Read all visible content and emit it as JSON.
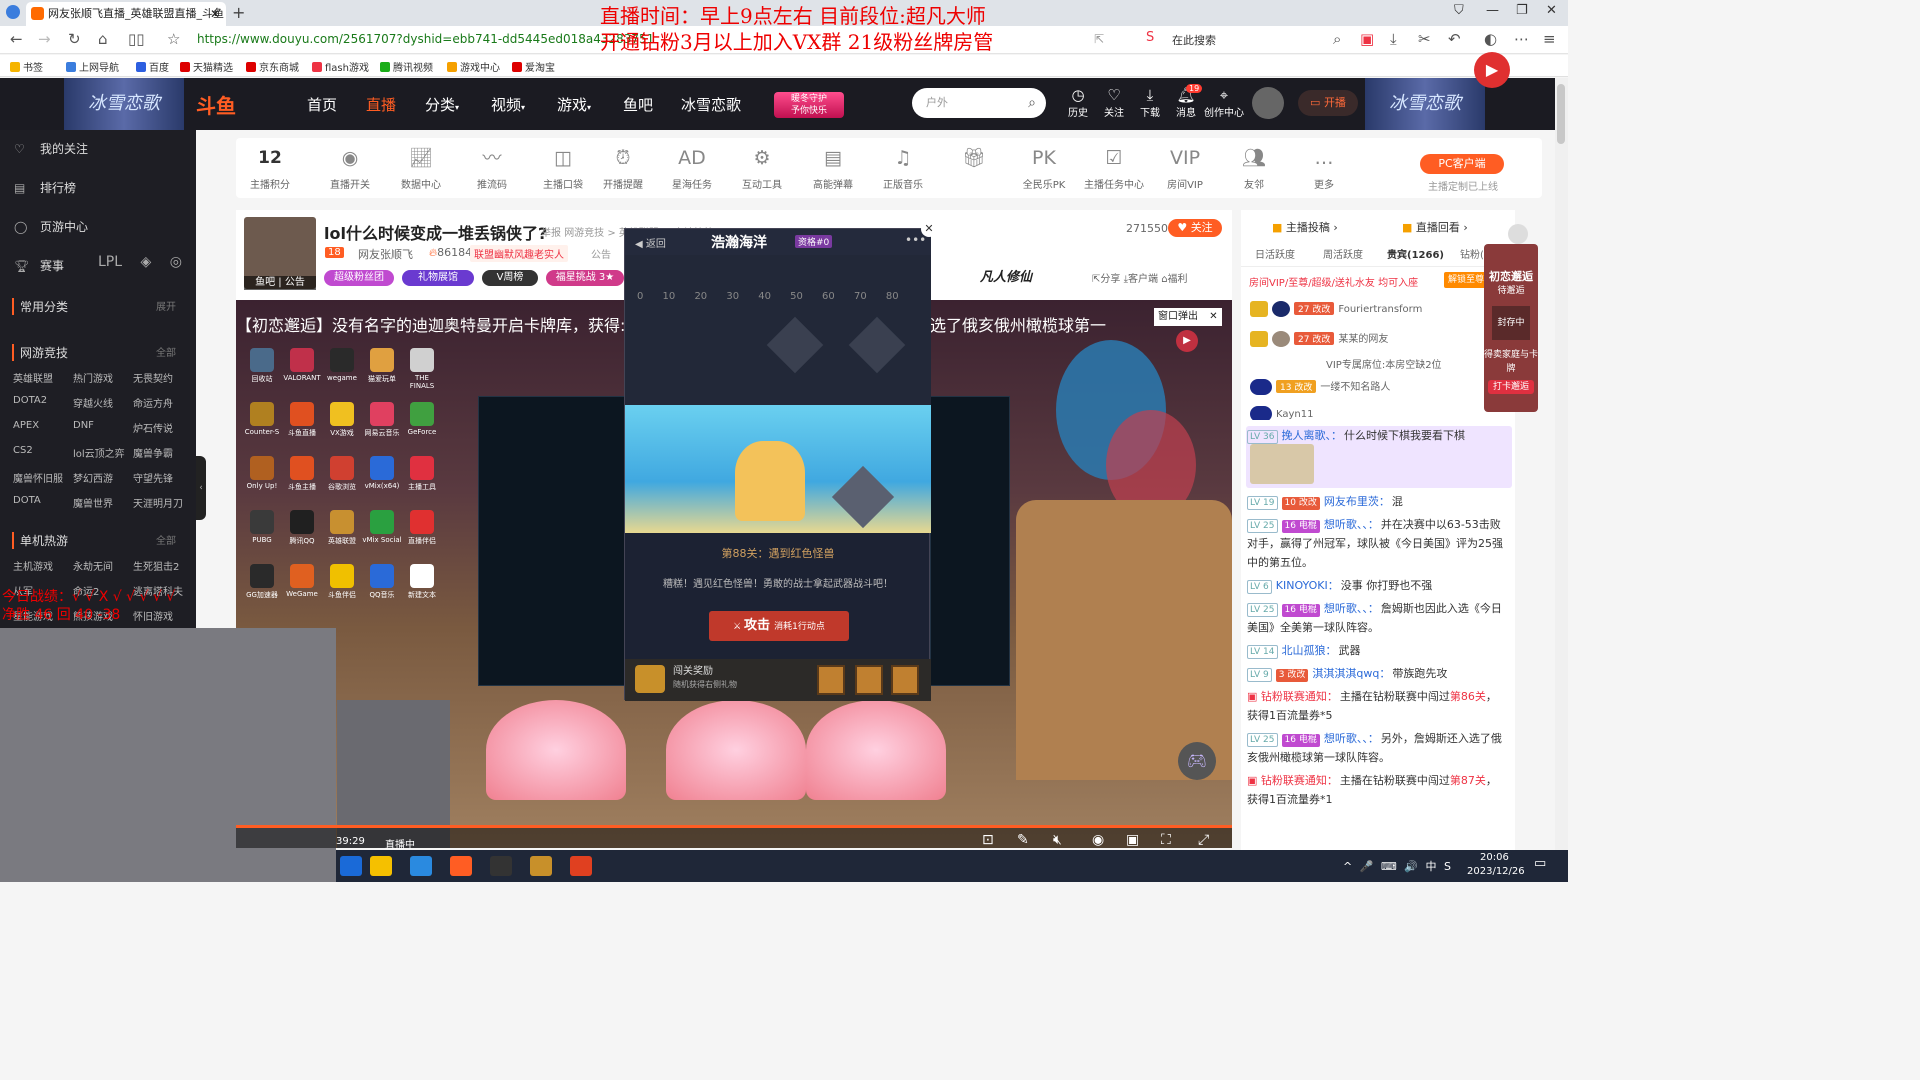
{
  "browser": {
    "tab_title": "网友张顺飞直播_英雄联盟直播_斗鱼",
    "url": "https://www.douyu.com/2561707?dyshid=ebb741-dd5445ed018a43283751",
    "search_placeholder": "在此搜索",
    "bookmarks": [
      "书签",
      "上网导航",
      "百度",
      "天猫精选",
      "京东商城",
      "flash游戏",
      "腾讯视频",
      "游戏中心",
      "爱淘宝"
    ]
  },
  "overlay": {
    "line1": "直播时间：早上9点左右 目前段位:超凡大师",
    "line2": "开通钻粉3月以上加入VX群 21级粉丝牌房管",
    "battle_line1": "今日战绩：√ √ X √ √ √ √ √",
    "battle_line2": "净胜 46 回 40 -38"
  },
  "header": {
    "logo": "斗鱼",
    "banner_text": "冰雪恋歌",
    "nav": [
      "首页",
      "直播",
      "分类",
      "视频",
      "游戏",
      "鱼吧",
      "冰雪恋歌"
    ],
    "promo_top": "暖冬守护",
    "promo_bottom": "予你快乐",
    "search_placeholder": "户外",
    "icons": [
      {
        "label": "历史",
        "icon": "clock-icon"
      },
      {
        "label": "关注",
        "icon": "heart-icon"
      },
      {
        "label": "下载",
        "icon": "download-icon"
      },
      {
        "label": "消息",
        "icon": "bell-icon"
      },
      {
        "label": "创作中心",
        "icon": "location-icon"
      }
    ],
    "message_badge": "19",
    "open_live": "开播"
  },
  "sidebar": {
    "items": [
      {
        "label": "我的关注",
        "icon": "heart-icon"
      },
      {
        "label": "排行榜",
        "icon": "rank-icon"
      },
      {
        "label": "页游中心",
        "icon": "game-icon"
      },
      {
        "label": "赛事",
        "icon": "trophy-icon"
      }
    ],
    "common_title": "常用分类",
    "common_more": "展开",
    "online_title": "网游竞技",
    "online_more": "全部",
    "online_games": [
      "英雄联盟",
      "热门游戏",
      "无畏契约",
      "DOTA2",
      "穿越火线",
      "命运方舟",
      "APEX",
      "DNF",
      "炉石传说",
      "CS2",
      "lol云顶之弈",
      "魔兽争霸",
      "魔兽怀旧服",
      "梦幻西游",
      "守望先锋",
      "DOTA",
      "魔兽世界",
      "天涯明月刀"
    ],
    "single_title": "单机热游",
    "single_more": "全部",
    "single_games": [
      "主机游戏",
      "永劫无间",
      "生死狙击2",
      "从军",
      "命运2",
      "逃离塔科夫",
      "星能游戏",
      "熊孩游戏",
      "怀旧游戏"
    ]
  },
  "tools": {
    "score_value": "12",
    "score_label": "主播积分",
    "items": [
      "直播开关",
      "数据中心",
      "推流码",
      "主播口袋",
      "开播提醒",
      "星海任务",
      "互动工具",
      "高能弹幕",
      "正版音乐",
      "",
      "全民乐PK",
      "主播任务中心",
      "房间VIP",
      "友邻",
      "更多"
    ],
    "pc_client": "PC客户端",
    "pc_note": "主播定制已上线"
  },
  "room": {
    "title": "lol什么时候变成一堆丢锅侠了?",
    "report": "举报",
    "category": "网游竞技 > 英雄联盟 > 大神护航",
    "level": "18",
    "streamer": "网友张顺飞",
    "hot": "861845",
    "league_tag": "联盟幽默风趣老实人",
    "notice": "公告",
    "avatar_caption": "鱼吧 | 公告",
    "pills": [
      "超级粉丝团",
      "礼物展馆",
      "V周榜",
      "福星挑战 3★"
    ],
    "viewers": "271550",
    "follow": "关注",
    "brand": "凡人修仙",
    "share": "分享",
    "client": "客户端",
    "welfare": "福利"
  },
  "video": {
    "marquee": "【初恋邂逅】没有名字的迪迦奥特曼开启卡牌库，获得:",
    "marquee_right": "选了俄亥俄州橄榄球第一",
    "popup_label": "窗口弹出",
    "desktop_icons": [
      "回收站",
      "VALORANT",
      "wegame",
      "猫爱玩单",
      "THE FINALS",
      "Counter-S",
      "斗鱼直播",
      "VX游戏",
      "网易云音乐",
      "GeForce",
      "Only Up!",
      "斗鱼主播",
      "谷歌浏览",
      "vMix(x64)",
      "主播工具",
      "PUBG",
      "腾讯QQ",
      "英雄联盟",
      "vMix Social",
      "直播伴侣",
      "GG加速器",
      "WeGame",
      "斗鱼伴侣",
      "QQ音乐",
      "新建文本"
    ],
    "timecode": "39:29",
    "live": "直播中"
  },
  "game": {
    "back": "返回",
    "title": "浩瀚海洋",
    "badge": "资格#0",
    "axis": "0 10 20 30 40 50 60 70 80",
    "level_title": "第88关：遇到红色怪兽",
    "level_msg": "糟糕！遇见红色怪兽！勇敢的战士拿起武器战斗吧！",
    "attack": "攻击",
    "attack_cost": "消耗1行动点",
    "reward_title": "闯关奖励",
    "reward_sub": "随机获得右侧礼物"
  },
  "right": {
    "tab_top1": "主播投稿",
    "tab_top2": "直播回看",
    "tabs": [
      "日活跃度",
      "周活跃度",
      "贵宾(1266)",
      "钻粉(26)"
    ],
    "vip_line": "房间VIP/至尊/超级/送礼水友 均可入座",
    "unlock": "解锁至尊",
    "vip_rows": [
      {
        "lvl": "27 改改",
        "name": "Fouriertransform"
      },
      {
        "lvl": "27 改改",
        "name": "某某的网友"
      }
    ],
    "vip_seat": "VIP专属席位:本房空缺2位",
    "vip_row3": {
      "lvl": "13 改改",
      "name": "一缕不知名路人"
    },
    "vip_row4": "Kayn11",
    "side_banner": [
      "初恋邂逅",
      "待邂逅",
      "封存中",
      "得卖家庭与卡牌",
      "打卡邂逅"
    ]
  },
  "chat": [
    {
      "lv": "LV 36",
      "fan": "",
      "nick": "挽人离歌、：",
      "text": "什么时候下棋我要看下棋",
      "featured": true
    },
    {
      "lv": "LV 19",
      "fan": "10 改改",
      "nick": "网友布里茨：",
      "text": "混"
    },
    {
      "lv": "LV 25",
      "fan": "16 电棍",
      "nick": "想听歌、、：",
      "text": "并在决赛中以63-53击败对手，赢得了州冠军，球队被《今日美国》评为25强中的第五位。"
    },
    {
      "lv": "LV 6",
      "fan": "",
      "nick": "KINOYOKI：",
      "text": "没事 你打野也不强"
    },
    {
      "lv": "LV 25",
      "fan": "16 电棍",
      "nick": "想听歌、、：",
      "text": "詹姆斯也因此入选《今日美国》全美第一球队阵容。"
    },
    {
      "lv": "LV 14",
      "fan": "",
      "nick": "北山孤狼：",
      "text": "武器"
    },
    {
      "lv": "LV 9",
      "fan": "3 改改",
      "nick": "淇淇淇淇qwq：",
      "text": "带族跑先攻"
    },
    {
      "sys": true,
      "nick": "钻粉联赛通知：",
      "text": "主播在钻粉联赛中闯过",
      "em": "第86关",
      "tail": "，获得1百流量券*5"
    },
    {
      "lv": "LV 25",
      "fan": "16 电棍",
      "nick": "想听歌、、：",
      "text": "另外，詹姆斯还入选了俄亥俄州橄榄球第一球队阵容。"
    },
    {
      "sys": true,
      "nick": "钻粉联赛通知：",
      "text": "主播在钻粉联赛中闯过",
      "em": "第87关",
      "tail": "，获得1百流量券*1"
    }
  ],
  "taskbar": {
    "time": "20:06",
    "date": "2023/12/26",
    "tray": "^ 🎤 ⌨ 🔊 中 S"
  }
}
